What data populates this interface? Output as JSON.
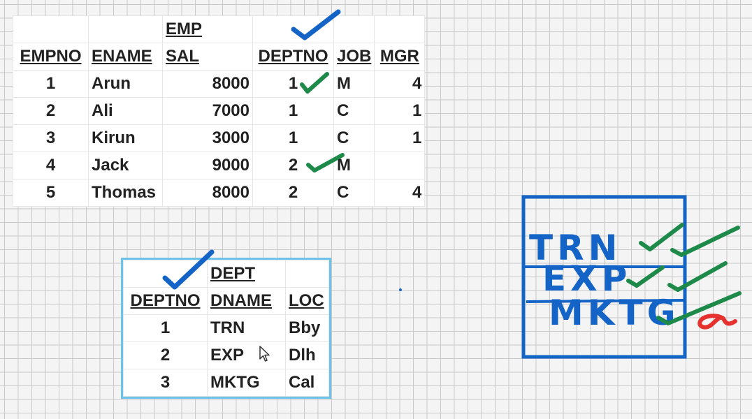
{
  "emp": {
    "title": "EMP",
    "headers": [
      "EMPNO",
      "ENAME",
      "SAL",
      "DEPTNO",
      "JOB",
      "MGR"
    ],
    "rows": [
      [
        "1",
        "Arun",
        "8000",
        "1",
        "M",
        "4"
      ],
      [
        "2",
        "Ali",
        "7000",
        "1",
        "C",
        "1"
      ],
      [
        "3",
        "Kirun",
        "3000",
        "1",
        "C",
        "1"
      ],
      [
        "4",
        "Jack",
        "9000",
        "2",
        "M",
        ""
      ],
      [
        "5",
        "Thomas",
        "8000",
        "2",
        "C",
        "4"
      ]
    ]
  },
  "dept": {
    "title": "DEPT",
    "headers": [
      "DEPTNO",
      "DNAME",
      "LOC"
    ],
    "rows": [
      [
        "1",
        "TRN",
        "Bby"
      ],
      [
        "2",
        "EXP",
        "Dlh"
      ],
      [
        "3",
        "MKTG",
        "Cal"
      ]
    ]
  },
  "whiteboard": {
    "labels": [
      "TRN",
      "EXP",
      "MKTG"
    ]
  },
  "colors": {
    "ink_blue": "#1463c6",
    "ink_green": "#1e8a4a",
    "ink_red": "#e5322e",
    "dept_border": "#6cc3ea"
  },
  "icons": [
    "checkmark-icon",
    "alpha-symbol-icon",
    "mouse-pointer-icon"
  ]
}
